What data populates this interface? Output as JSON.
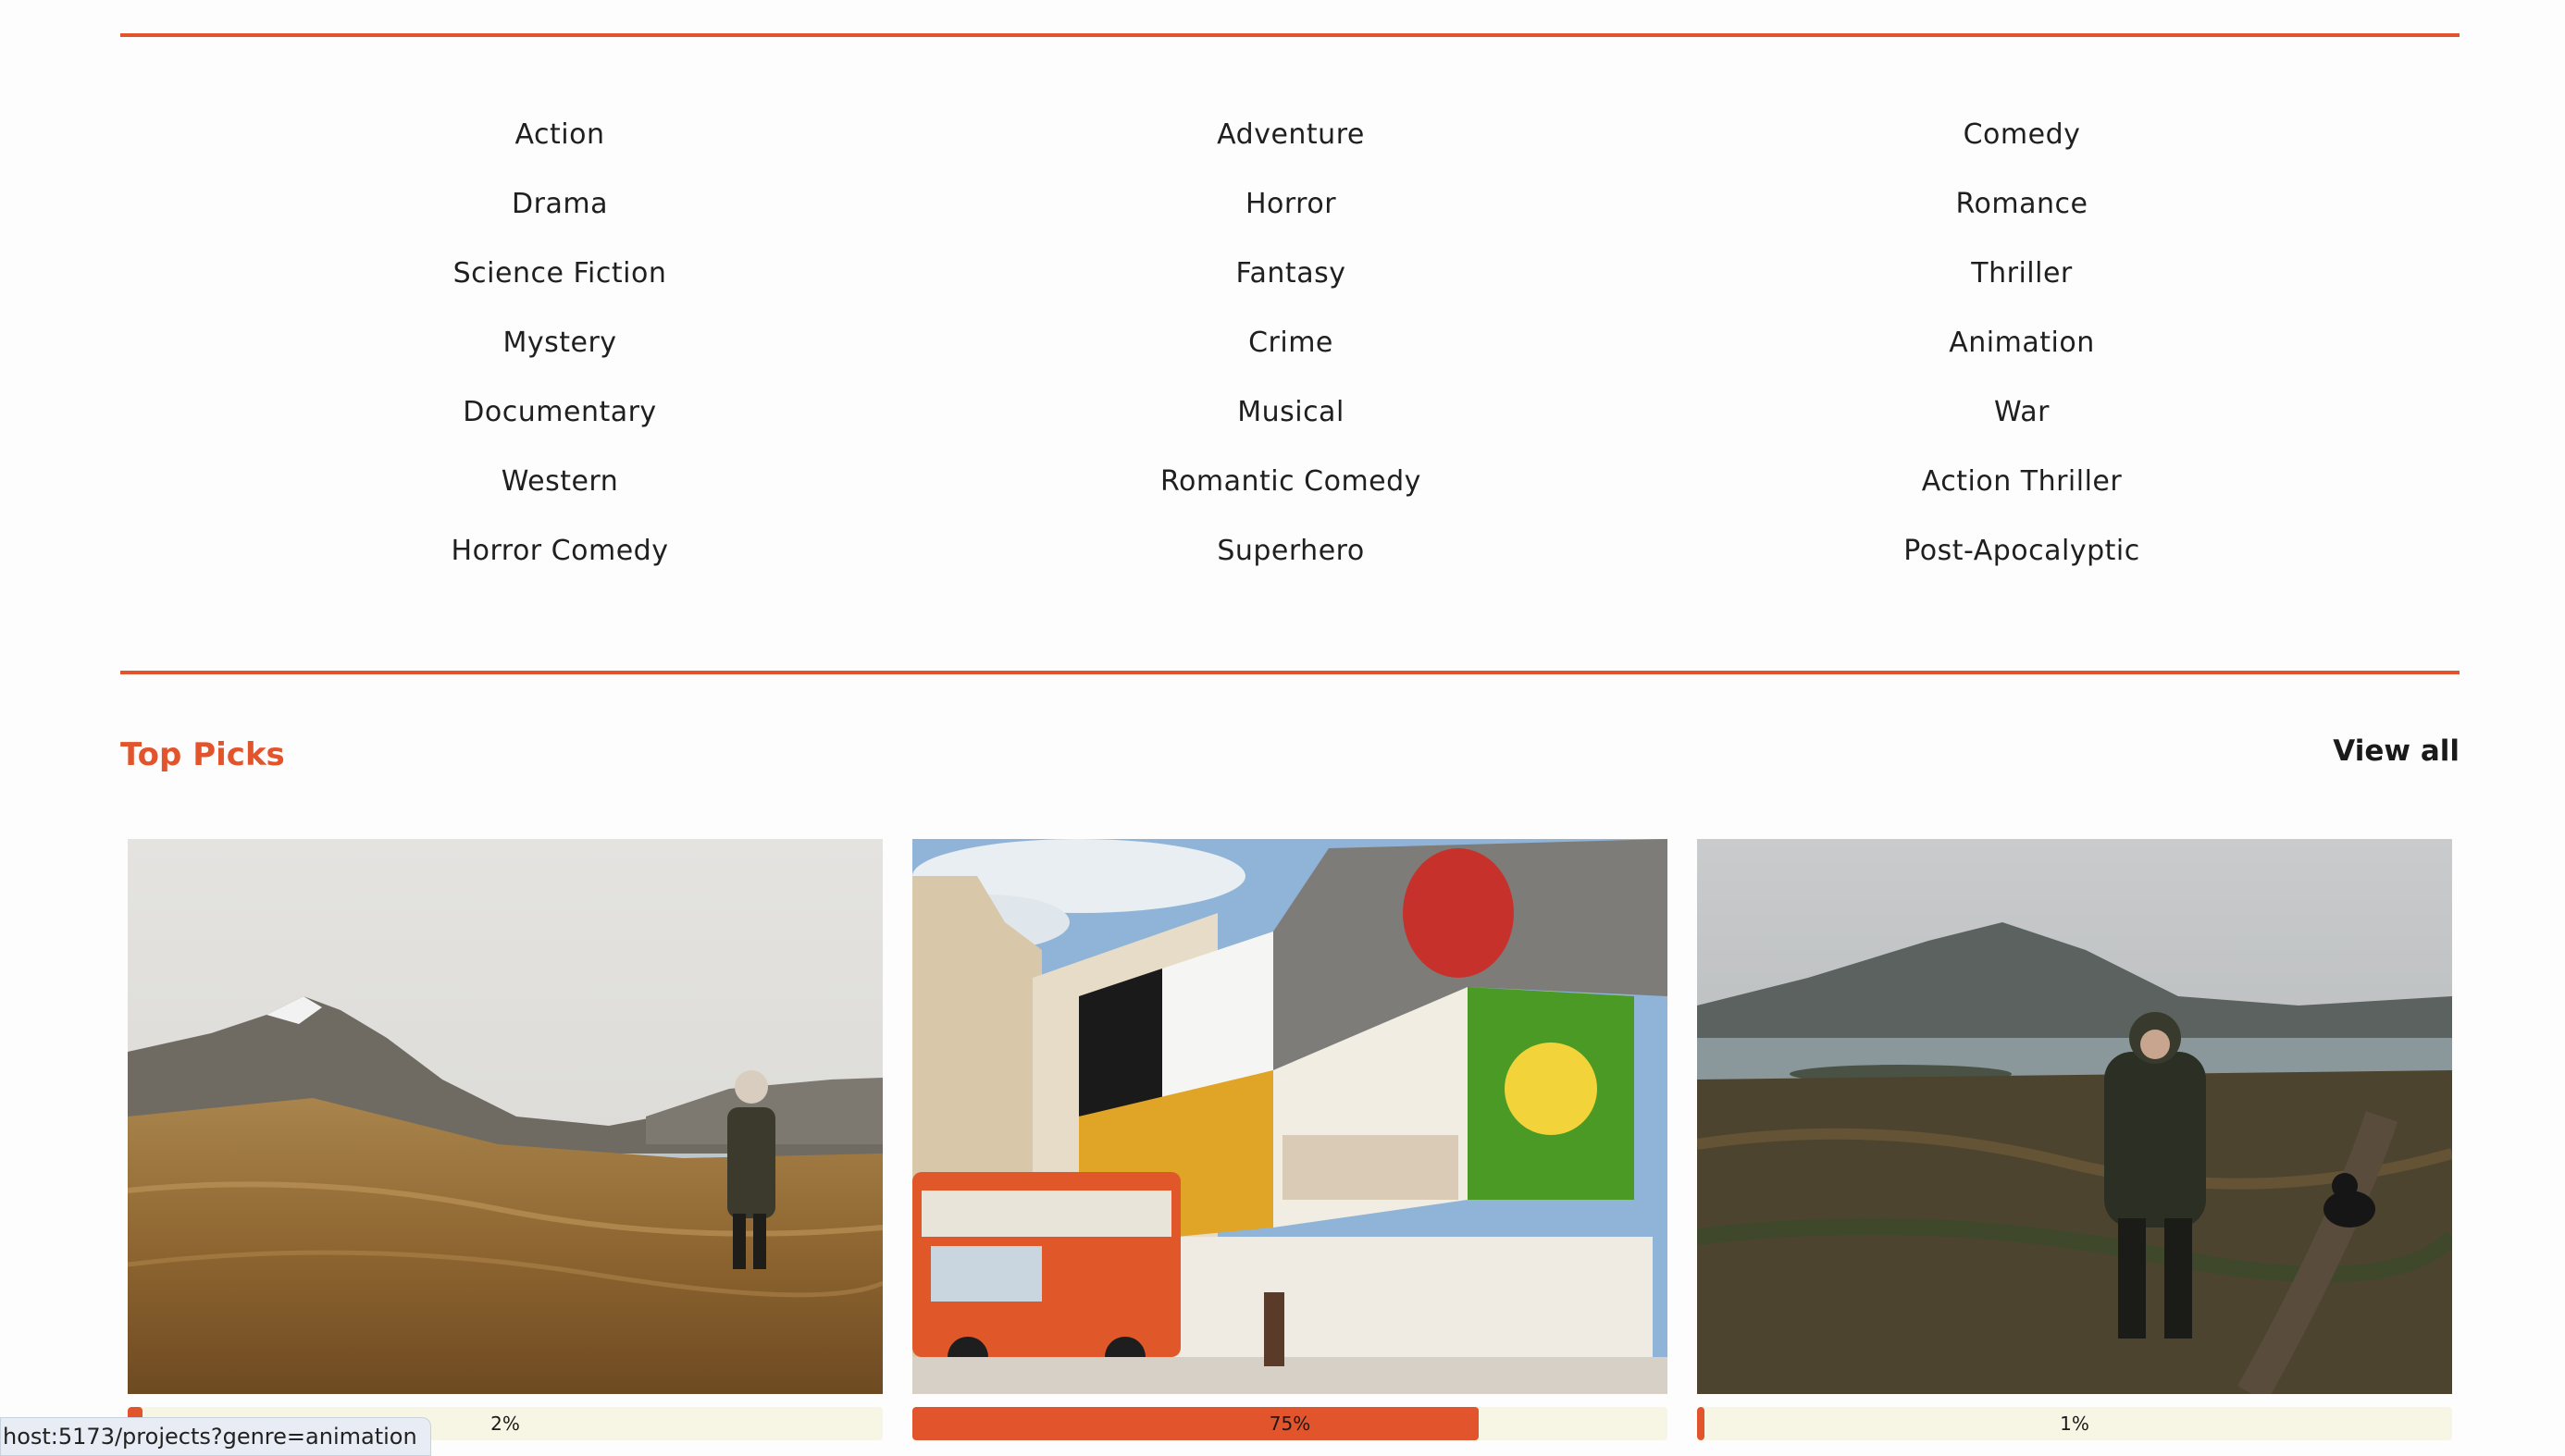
{
  "genres": [
    "Action",
    "Adventure",
    "Comedy",
    "Drama",
    "Horror",
    "Romance",
    "Science Fiction",
    "Fantasy",
    "Thriller",
    "Mystery",
    "Crime",
    "Animation",
    "Documentary",
    "Musical",
    "War",
    "Western",
    "Romantic Comedy",
    "Action Thriller",
    "Horror Comedy",
    "Superhero",
    "Post-Apocalyptic"
  ],
  "top_picks": {
    "title": "Top Picks",
    "view_all_label": "View all",
    "cards": [
      {
        "progress_label": "2%",
        "progress_value": 0.02
      },
      {
        "progress_label": "75%",
        "progress_value": 0.75
      },
      {
        "progress_label": "1%",
        "progress_value": 0.01
      }
    ]
  },
  "status_bar": {
    "url": "host:5173/projects?genre=animation"
  },
  "colors": {
    "accent": "#e2542c",
    "progress_track": "#f7f5e4"
  }
}
